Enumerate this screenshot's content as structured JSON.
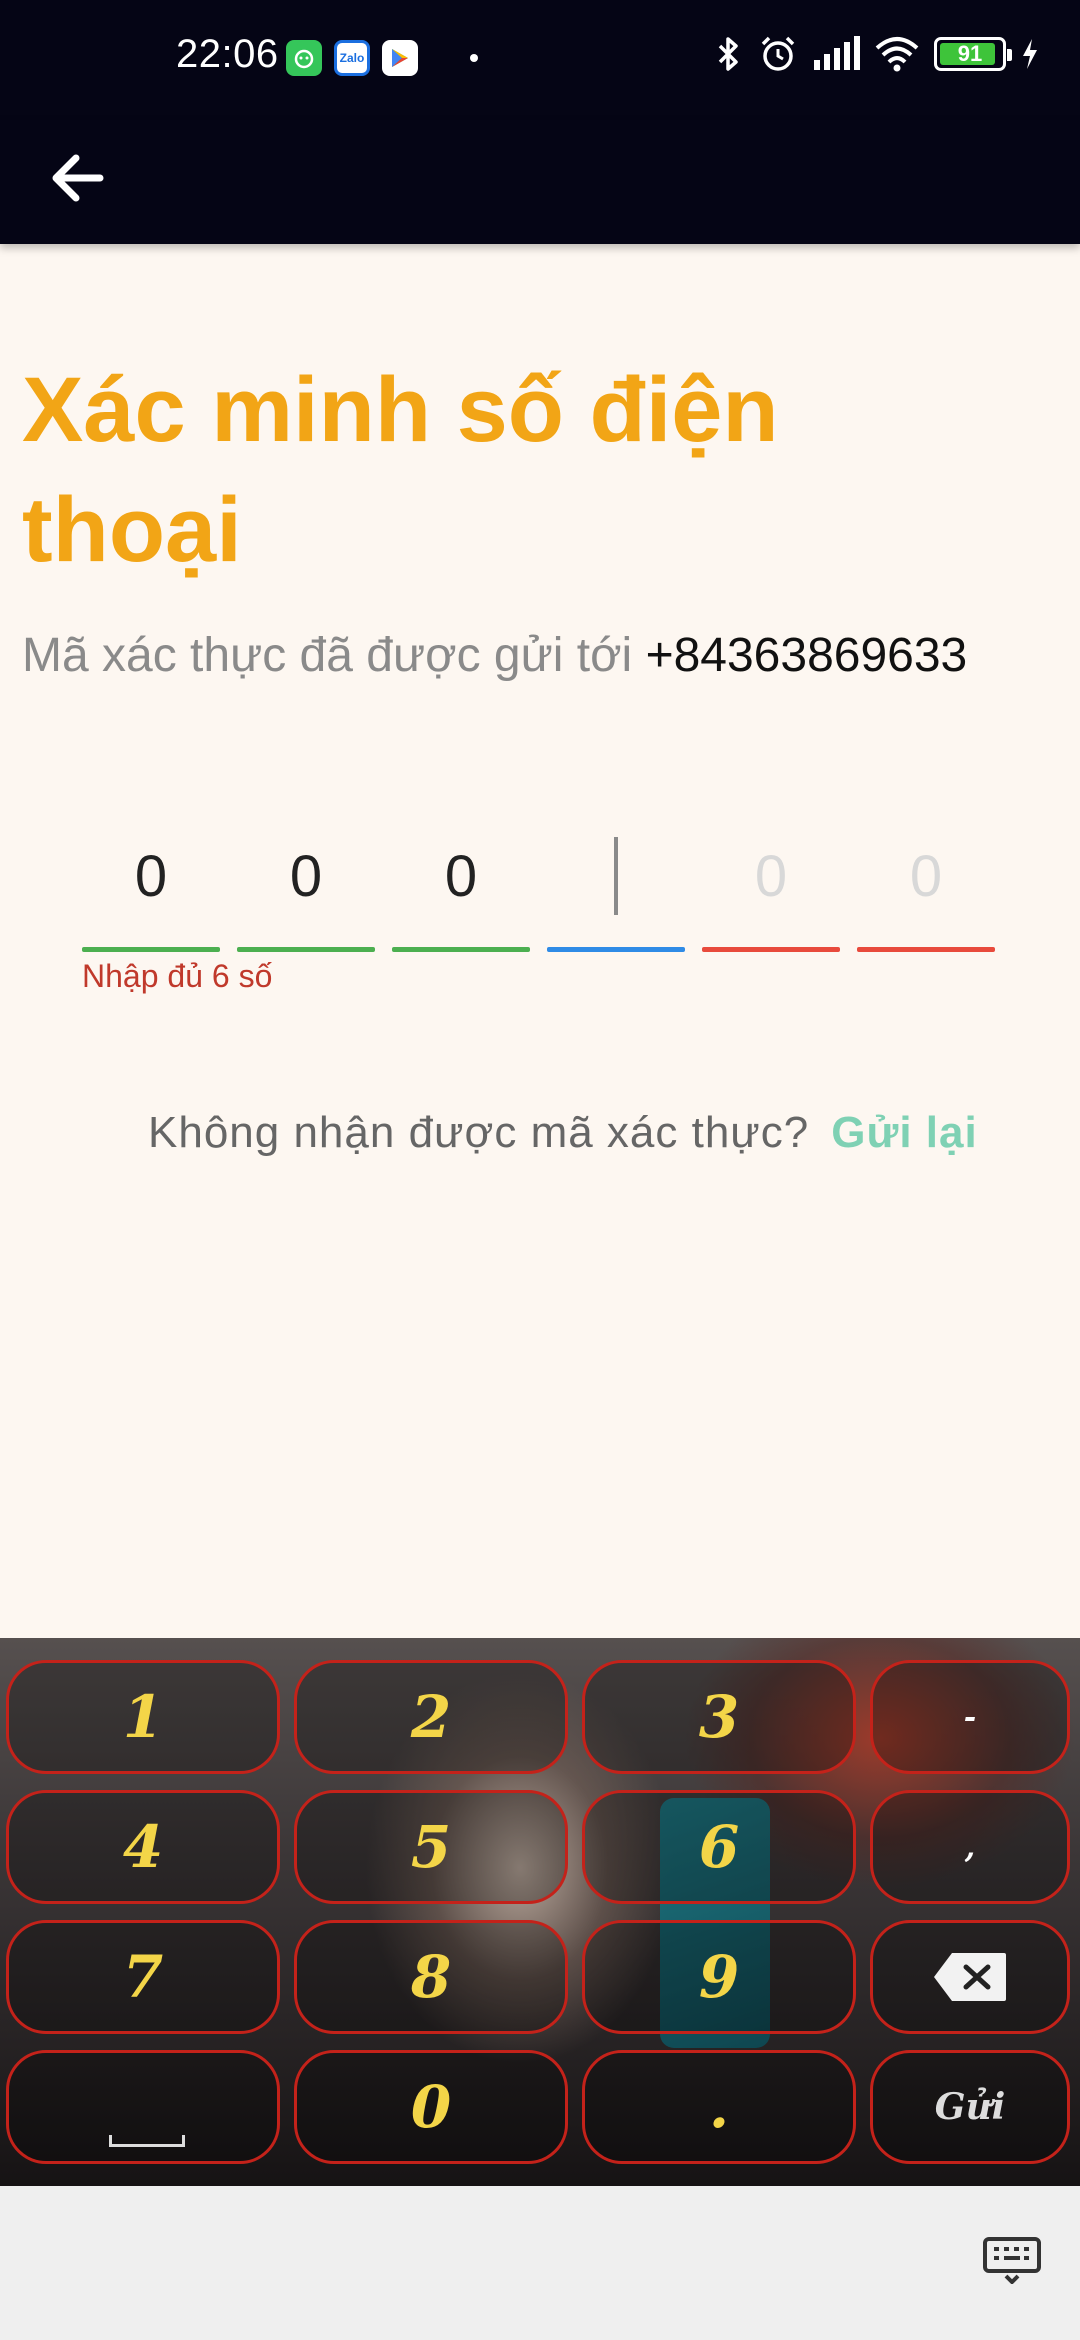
{
  "status_bar": {
    "time": "22:06",
    "notification_icons": [
      "cat-app-icon",
      "zalo-icon",
      "google-play-icon"
    ],
    "zalo_text": "Zalo",
    "battery_level": "91",
    "system_icons": [
      "bluetooth-icon",
      "alarm-icon",
      "signal-icon",
      "wifi-icon",
      "battery-icon",
      "charging-icon"
    ]
  },
  "app_bar": {
    "back_icon": "arrow-left-icon"
  },
  "page": {
    "title": "Xác minh số điện thoại",
    "subtitle_prefix": "Mã xác thực đã được gửi tới",
    "phone_number": "+84363869633",
    "otp_digits": [
      "0",
      "0",
      "0",
      "",
      "0",
      "0"
    ],
    "error_text": "Nhập đủ 6 số",
    "resend_prompt": "Không nhận được mã xác thực?",
    "resend_link": "Gửi lại"
  },
  "keyboard": {
    "keys": [
      "1",
      "2",
      "3",
      "-",
      "4",
      "5",
      "6",
      ",",
      "7",
      "8",
      "9",
      "",
      "",
      "0",
      ".",
      "Gửi"
    ],
    "backspace_icon": "backspace-icon",
    "space_icon": "space-icon",
    "toggle_icon": "keyboard-icon"
  },
  "colors": {
    "title": "#f2a516",
    "resend_link": "#7fd1b4",
    "underline_filled": "#4caf50",
    "underline_active": "#2f8be6",
    "underline_empty": "#e84a3c",
    "error": "#c0392b",
    "key_border": "#c4221a",
    "key_text": "#f3d548"
  }
}
